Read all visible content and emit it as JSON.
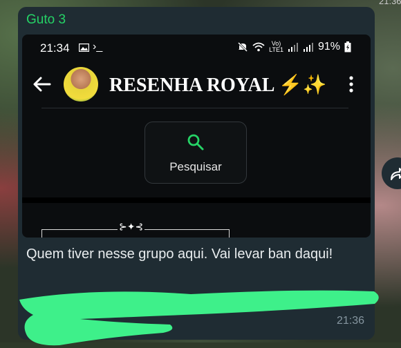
{
  "chat": {
    "sender": "Guto 3",
    "message": "Quem tiver nesse grupo aqui. Vai levar ban daqui!",
    "time": "21:36"
  },
  "screenshot": {
    "status_bar": {
      "time": "21:34",
      "terminal_glyph": "›_",
      "volte_top": "Vo)",
      "volte_bottom": "LTE1",
      "battery": "91%"
    },
    "app_bar": {
      "group_name": "RESENHA ROYAL ⚡✨"
    },
    "search_button": {
      "label": "Pesquisar"
    },
    "ornament": "⊱✦⊰"
  },
  "corner_text": "21:36",
  "colors": {
    "sender": "#25d366",
    "bubble": "#1f2c33",
    "scribble": "#3ef08a"
  },
  "icons": [
    "back-arrow-icon",
    "kebab-menu-icon",
    "search-icon",
    "forward-icon",
    "image-icon",
    "mute-icon",
    "wifi-icon",
    "signal-icon",
    "battery-icon"
  ]
}
